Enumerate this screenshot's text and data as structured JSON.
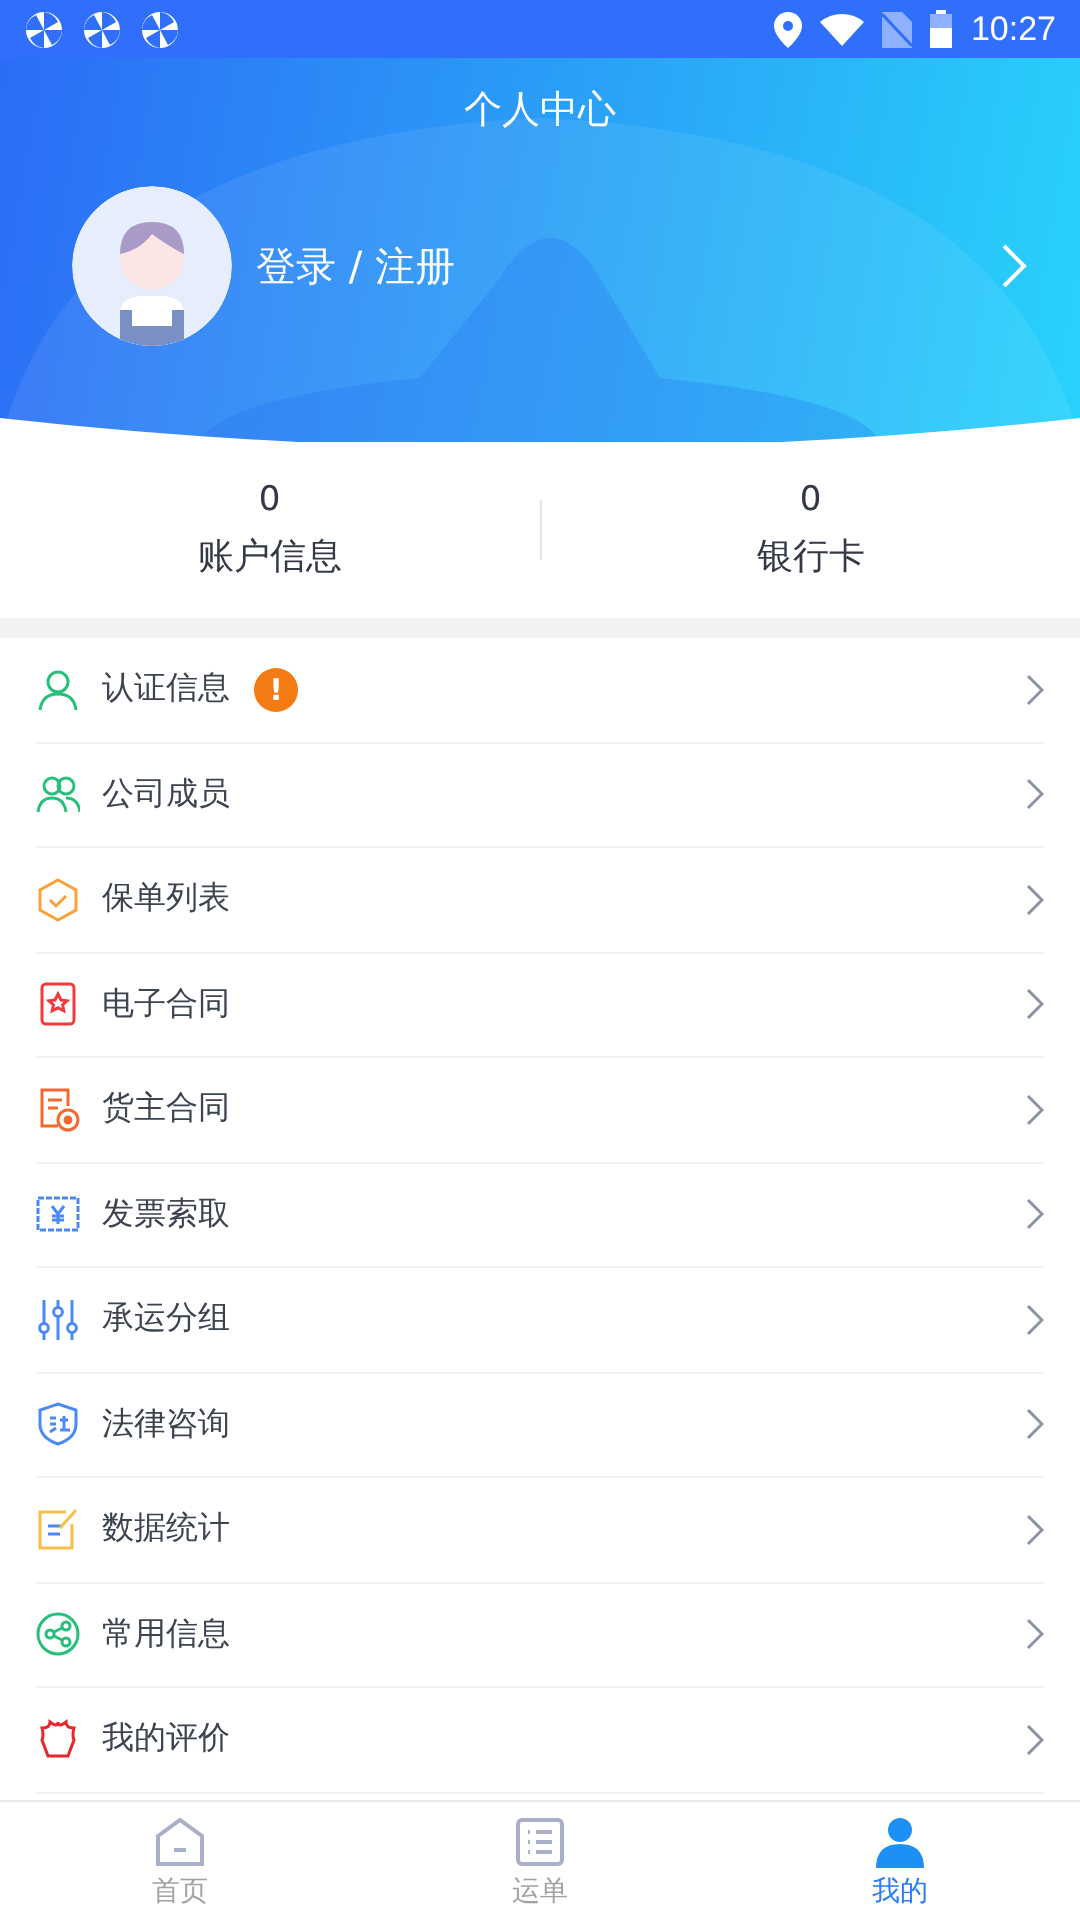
{
  "status_bar": {
    "time": "10:27"
  },
  "header": {
    "title": "个人中心",
    "login_label": "登录 / 注册"
  },
  "stats": [
    {
      "value": "0",
      "label": "账户信息"
    },
    {
      "value": "0",
      "label": "银行卡"
    }
  ],
  "menu": [
    {
      "kind": "person",
      "label": "认证信息",
      "alert": true,
      "alert_text": "!"
    },
    {
      "kind": "people",
      "label": "公司成员",
      "alert": false
    },
    {
      "kind": "shield-check",
      "label": "保单列表",
      "alert": false
    },
    {
      "kind": "contract",
      "label": "电子合同",
      "alert": false
    },
    {
      "kind": "doc-badge",
      "label": "货主合同",
      "alert": false
    },
    {
      "kind": "invoice",
      "label": "发票索取",
      "alert": false
    },
    {
      "kind": "sliders",
      "label": "承运分组",
      "alert": false
    },
    {
      "kind": "law",
      "label": "法律咨询",
      "alert": false
    },
    {
      "kind": "note",
      "label": "数据统计",
      "alert": false
    },
    {
      "kind": "share",
      "label": "常用信息",
      "alert": false
    },
    {
      "kind": "flower",
      "label": "我的评价",
      "alert": false
    }
  ],
  "tabs": [
    {
      "kind": "home",
      "label": "首页",
      "selected": false
    },
    {
      "kind": "list",
      "label": "运单",
      "selected": false
    },
    {
      "kind": "me",
      "label": "我的",
      "selected": true
    }
  ]
}
